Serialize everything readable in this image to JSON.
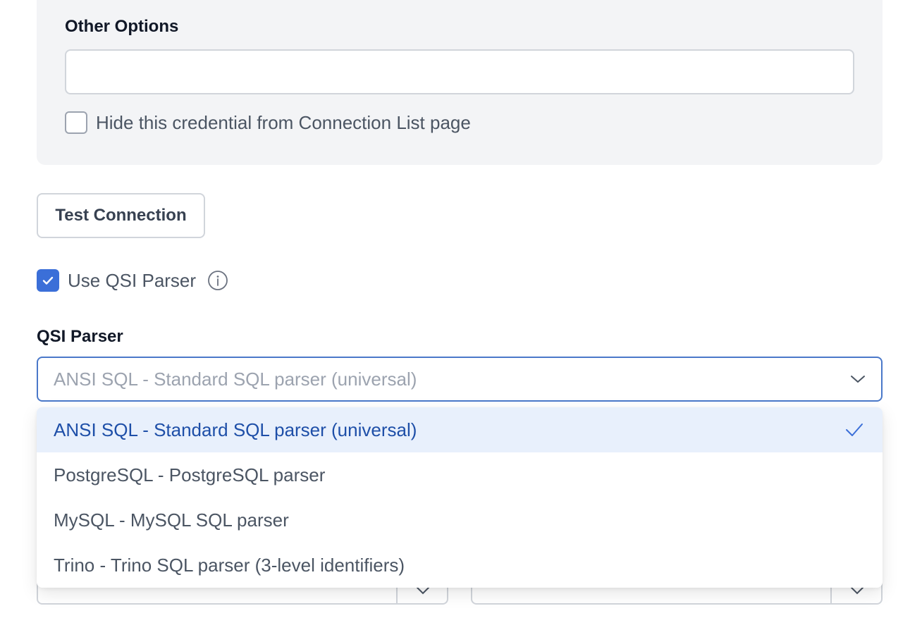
{
  "other_options": {
    "label": "Other Options",
    "value": "",
    "placeholder": ""
  },
  "hide_credential": {
    "label": "Hide this credential from Connection List page",
    "checked": false
  },
  "test_connection": {
    "label": "Test Connection"
  },
  "use_qsi": {
    "label": "Use QSI Parser",
    "checked": true
  },
  "qsi_parser": {
    "label": "QSI Parser",
    "selected_value": "ANSI SQL - Standard SQL parser (universal)",
    "options": [
      {
        "label": "ANSI SQL - Standard SQL parser (universal)",
        "selected": true
      },
      {
        "label": "PostgreSQL - PostgreSQL parser",
        "selected": false
      },
      {
        "label": "MySQL - MySQL SQL parser",
        "selected": false
      },
      {
        "label": "Trino - Trino SQL parser (3-level identifiers)",
        "selected": false
      }
    ]
  },
  "colors": {
    "accent": "#3b6fd8",
    "selected_bg": "#e8f0fc",
    "selected_text": "#1e4fa8",
    "panel_bg": "#f3f4f6"
  },
  "icons": {
    "info": "info-circle-icon",
    "chevron": "chevron-down-icon",
    "check": "checkmark-icon"
  }
}
